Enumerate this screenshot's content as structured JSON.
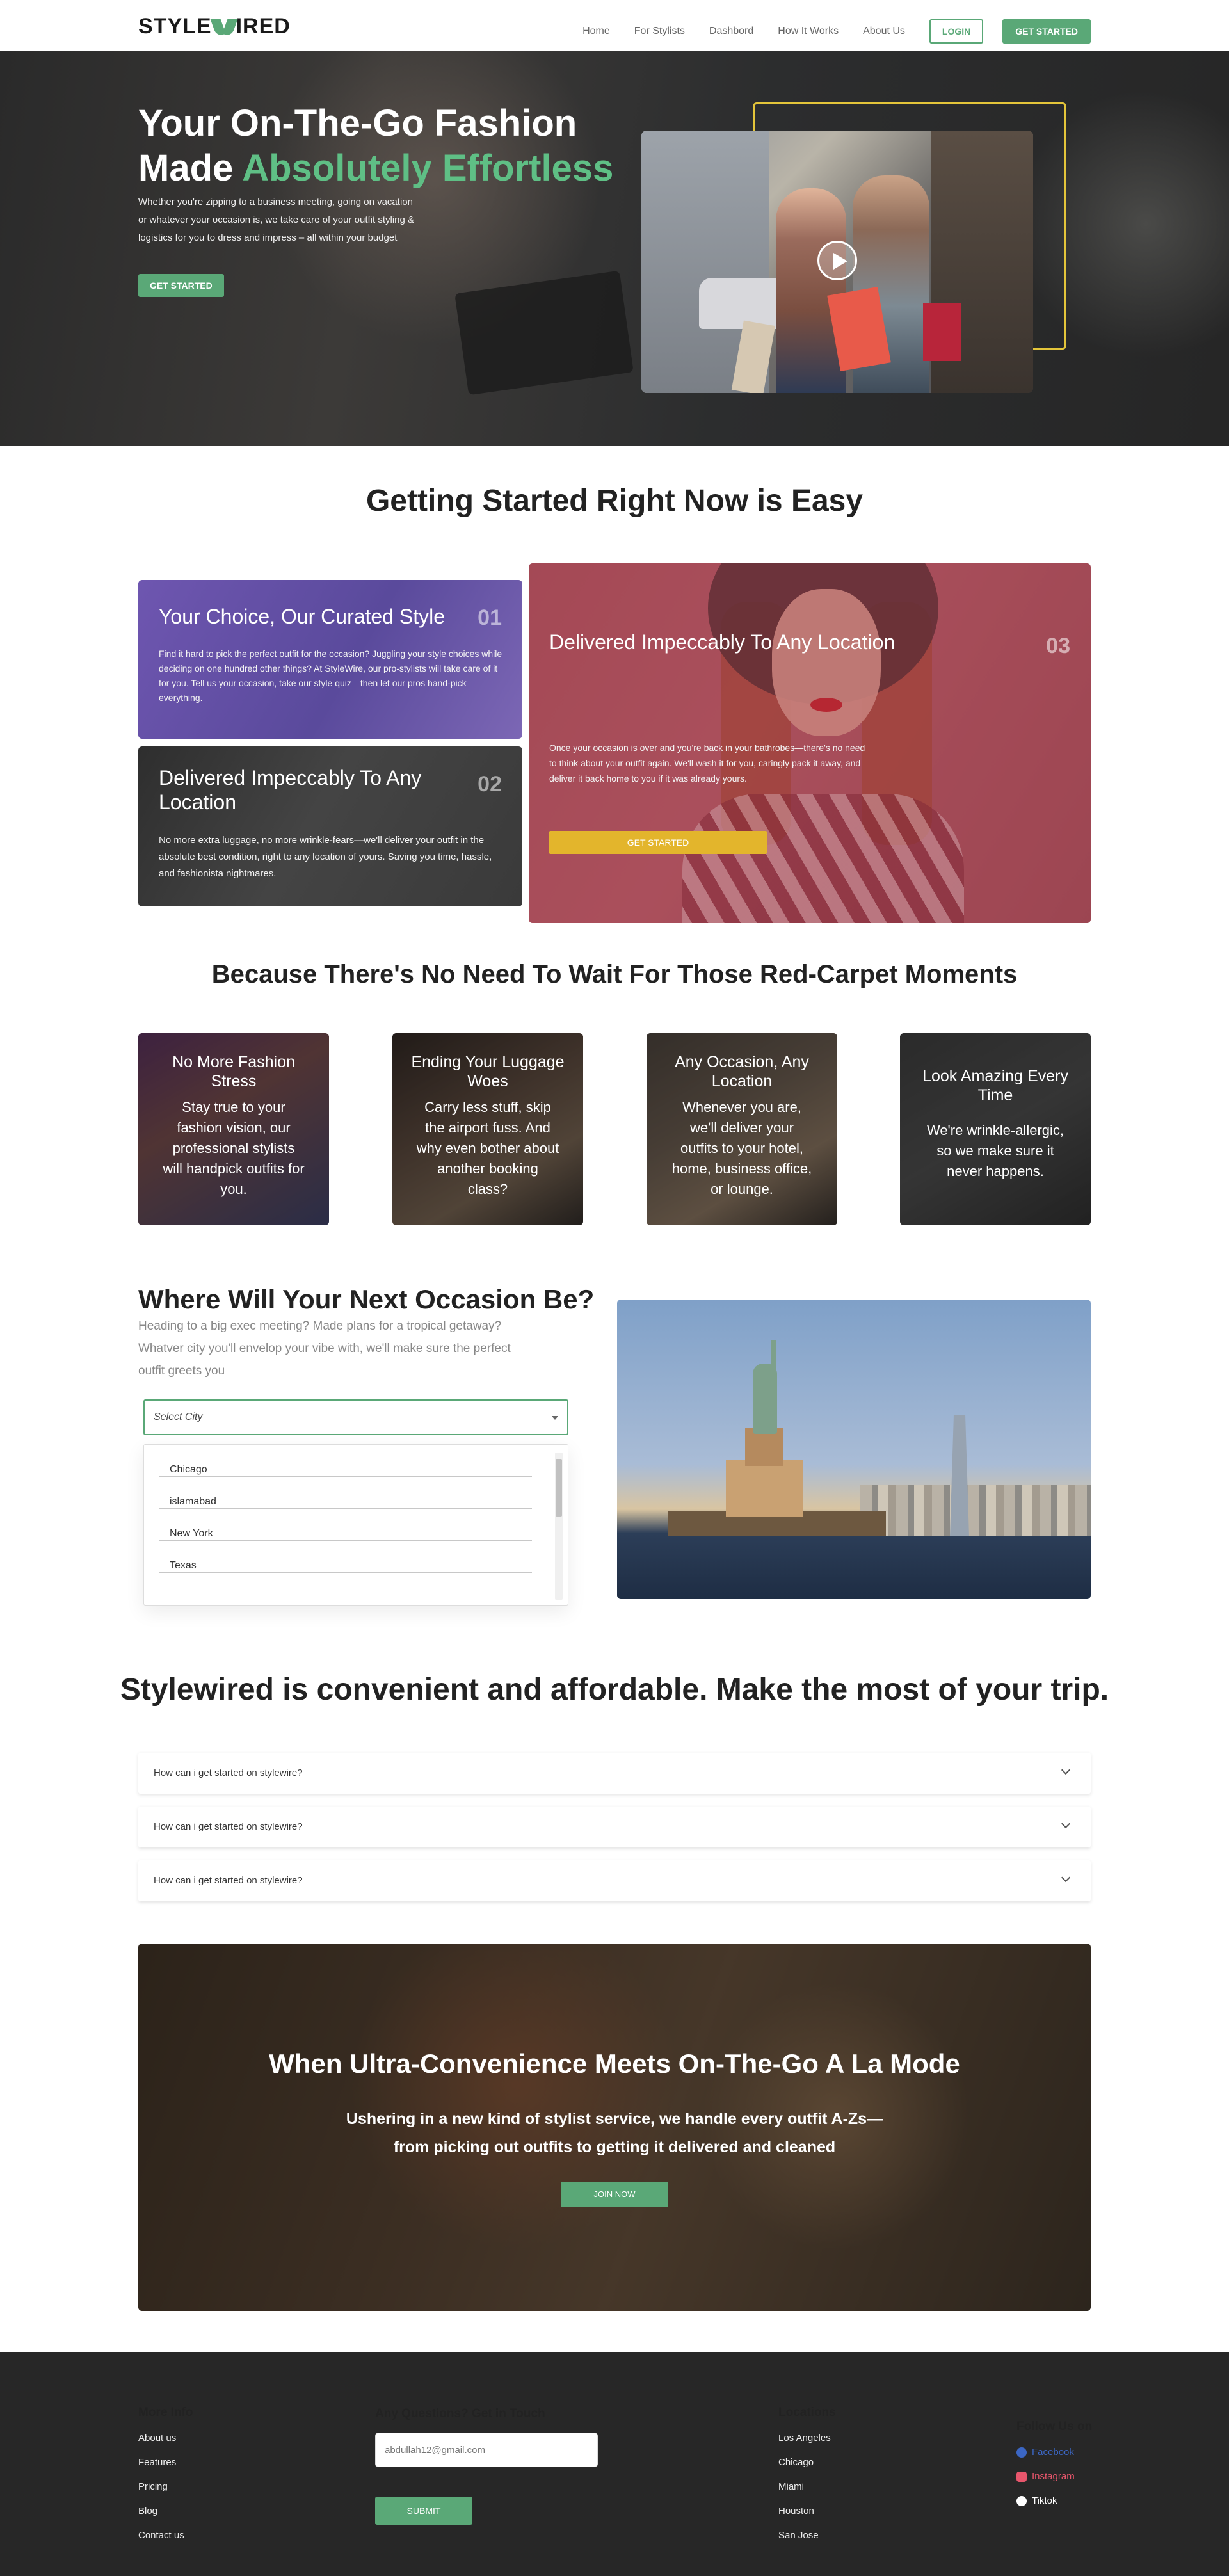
{
  "header": {
    "logo_left": "STYLE",
    "logo_right": "IRED",
    "nav": [
      "Home",
      "For Stylists",
      "Dashbord",
      "How It Works",
      "About Us"
    ],
    "login": "LOGIN",
    "get_started": "GET STARTED"
  },
  "hero": {
    "title_line1": "Your On-The-Go Fashion",
    "title_line2a": "Made ",
    "title_line2b": "Absolutely Effortless",
    "subtitle": "Whether you're zipping to a business meeting, going on vacation or whatever your occasion is, we take care of your outfit styling & logistics for you to dress and impress – all within your budget",
    "button": "GET STARTED",
    "colors": {
      "accent": "#5fbf85",
      "frame": "#e4c53a"
    }
  },
  "steps": {
    "title": "Getting Started Right Now is Easy",
    "cards": [
      {
        "title": "Your Choice, Our Curated Style",
        "num": "01",
        "desc": "Find it hard to pick the perfect outfit for the occasion? Juggling your style choices while deciding on one hundred other things? At StyleWire, our pro-stylists will take care of it for you. Tell us your occasion, take our style quiz—then let our pros hand-pick everything."
      },
      {
        "title": "Delivered Impeccably To Any Location",
        "num": "02",
        "desc": "No more extra luggage, no more wrinkle-fears—we'll deliver your outfit in the absolute best condition, right to any location of yours. Saving you time, hassle, and fashionista nightmares."
      },
      {
        "title": "Delivered Impeccably To Any Location",
        "num": "03",
        "desc": "Once your occasion is over and you're back in your bathrobes—there's no need to think about your outfit again. We'll wash it for you, caringly pack it away, and deliver it back home to you if it was already yours.",
        "button": "GET STARTED"
      }
    ]
  },
  "features": {
    "title": "Because There's No Need To Wait For Those Red-Carpet Moments",
    "tiles": [
      {
        "title": "No More Fashion Stress",
        "text": "Stay true to your fashion vision, our professional stylists will handpick outfits for you."
      },
      {
        "title": "Ending Your Luggage Woes",
        "text": "Carry less stuff, skip the airport fuss. And why even bother about another booking class?"
      },
      {
        "title": "Any Occasion, Any Location",
        "text": "Whenever you are, we'll deliver your outfits to your hotel, home, business office, or lounge."
      },
      {
        "title": "Look Amazing Every Time",
        "text": "We're wrinkle-allergic, so we make sure it never happens."
      }
    ]
  },
  "where": {
    "title": "Where Will Your Next Occasion Be?",
    "text": "Heading to a big exec meeting? Made plans for a tropical getaway? Whatver city you'll envelop your vibe with, we'll make sure the perfect outfit greets you",
    "select_label": "Select City",
    "options": [
      "Chicago",
      "islamabad",
      "New York",
      "Texas"
    ]
  },
  "faq": {
    "title": "Stylewired is convenient and affordable. Make the most of your trip.",
    "items": [
      "How can i get started on stylewire?",
      "How can i get started on stylewire?",
      "How can i get started on stylewire?"
    ]
  },
  "banner": {
    "title": "When Ultra-Convenience Meets On-The-Go A La Mode",
    "text": "Ushering in a new kind of stylist service, we handle every outfit A-Zs—from picking out outfits to getting it delivered and cleaned",
    "button": "JOIN NOW"
  },
  "footer": {
    "more_info_title": "More Info",
    "more_info": [
      "About us",
      "Features",
      "Pricing",
      "Blog",
      "Contact us"
    ],
    "contact_title": "Any Questions? Get in Touch",
    "email_placeholder": "abdullah12@gmail.com",
    "submit": "SUBMIT",
    "locations_title": "Locations",
    "locations": [
      "Los Angeles",
      "Chicago",
      "Miami",
      "Houston",
      "San Jose"
    ],
    "follow_title": "Follow Us on",
    "social": [
      {
        "name": "Facebook",
        "color": "#3b66c4",
        "icon": "facebook-icon"
      },
      {
        "name": "Instagram",
        "color": "#e8566c",
        "icon": "instagram-icon"
      },
      {
        "name": "Tiktok",
        "color": "#ffffff",
        "icon": "tiktok-icon"
      }
    ]
  }
}
